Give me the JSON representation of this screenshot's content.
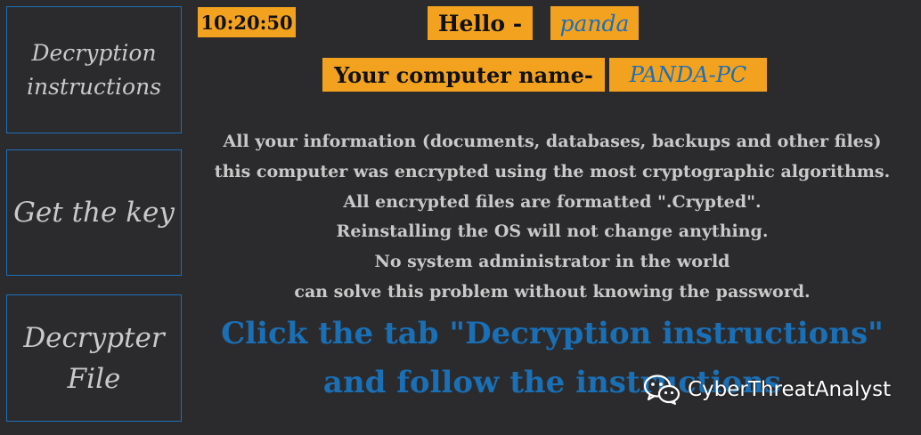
{
  "sidebar": {
    "decryption_instructions": "Decryption instructions",
    "get_the_key": "Get the key",
    "decrypter_file": "Decrypter File"
  },
  "header": {
    "timer": "10:20:50",
    "hello_label": "Hello -",
    "user_name": "panda",
    "computer_label": "Your computer name-",
    "computer_name": "PANDA-PC"
  },
  "message": {
    "lines": [
      "All your information (documents, databases, backups and other files)",
      "this computer was encrypted using the most cryptographic algorithms.",
      "All encrypted files are formatted \".Crypted\".",
      "Reinstalling the OS will not change anything.",
      "No system administrator in the world",
      "can solve this problem without knowing the password."
    ]
  },
  "cta": {
    "lines": [
      "Click the tab \"Decryption instructions\"",
      "and follow the instructions"
    ]
  },
  "watermark": {
    "text": "CyberThreatAnalyst",
    "icon": "wechat-icon"
  },
  "colors": {
    "background": "#2b2b2d",
    "accent_orange": "#f2a21e",
    "accent_blue": "#1f6fb8",
    "text_gray": "#c9c9c9"
  }
}
